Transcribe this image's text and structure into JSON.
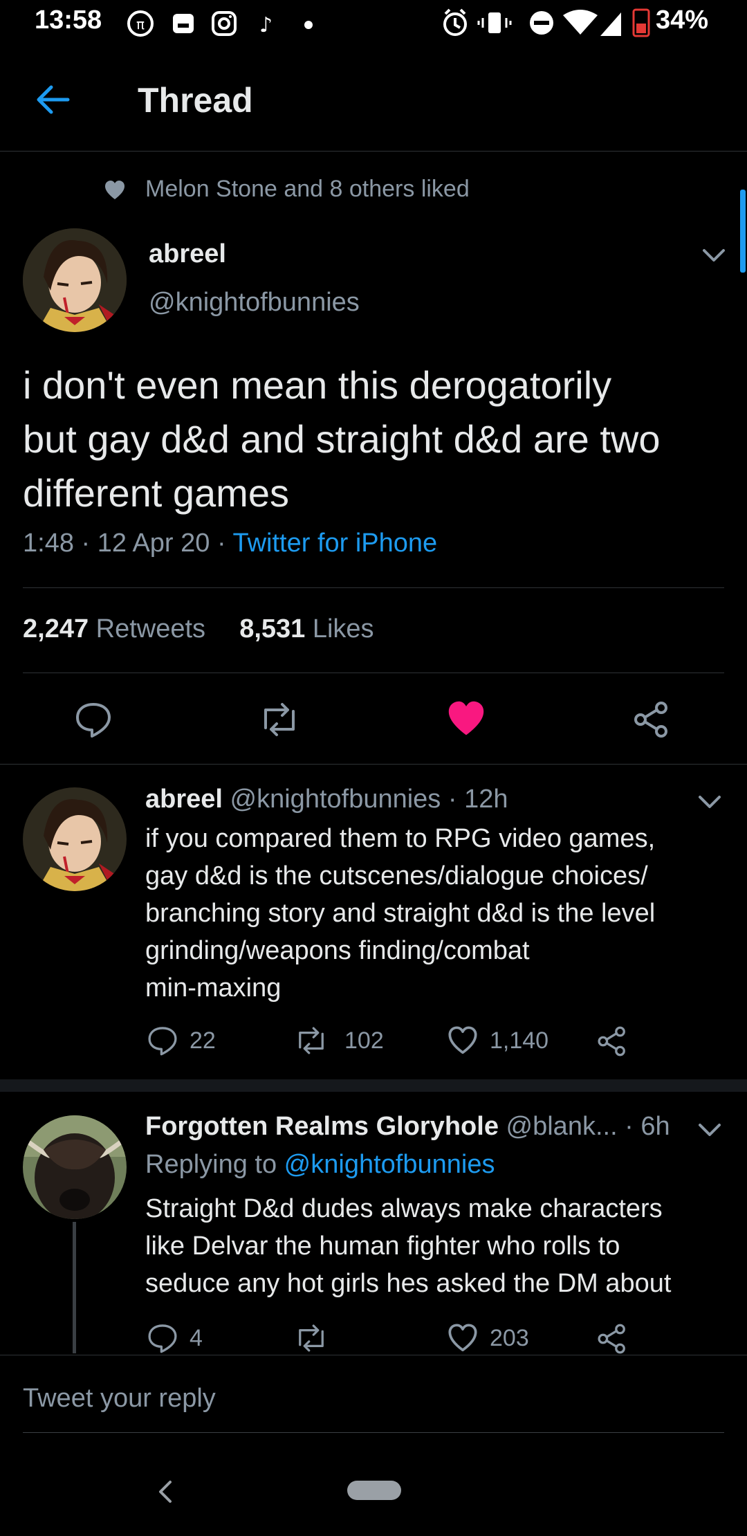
{
  "status_bar": {
    "time": "13:58",
    "battery": "34%"
  },
  "header": {
    "title": "Thread"
  },
  "liked_by": "Melon Stone and 8 others liked",
  "main_tweet": {
    "name": "abreel",
    "handle": "@knightofbunnies",
    "text_lines": [
      "i don't even mean this derogatorily",
      "but gay d&d and straight d&d are two",
      "different games"
    ],
    "time": "1:48 · 12 Apr 20 · ",
    "source": "Twitter for iPhone",
    "retweets_count": "2,247",
    "retweets_label": "Retweets",
    "likes_count": "8,531",
    "likes_label": "Likes"
  },
  "reply1": {
    "name": "abreel",
    "meta": "@knightofbunnies · 12h",
    "text_lines": [
      "if you compared them to RPG video games,",
      "gay d&d is the cutscenes/dialogue choices/",
      "branching story and straight d&d is the level",
      "grinding/weapons finding/combat",
      "min-maxing"
    ],
    "replies": "22",
    "retweets": "102",
    "likes": "1,140"
  },
  "reply2": {
    "name": "Forgotten Realms Gloryhole",
    "meta": "@blank... · 6h",
    "replying_prefix": "Replying to ",
    "replying_handle": "@knightofbunnies",
    "text_lines": [
      "Straight D&d dudes always make characters",
      "like Delvar the human fighter who rolls to",
      "seduce any hot girls hes asked the DM about"
    ],
    "replies": "4",
    "retweets": "",
    "likes": "203"
  },
  "reply_input": {
    "placeholder": "Tweet your reply"
  },
  "colors": {
    "accent": "#1d9bf0",
    "like": "#f91880",
    "background": "#000000",
    "muted": "#8b98a5"
  }
}
